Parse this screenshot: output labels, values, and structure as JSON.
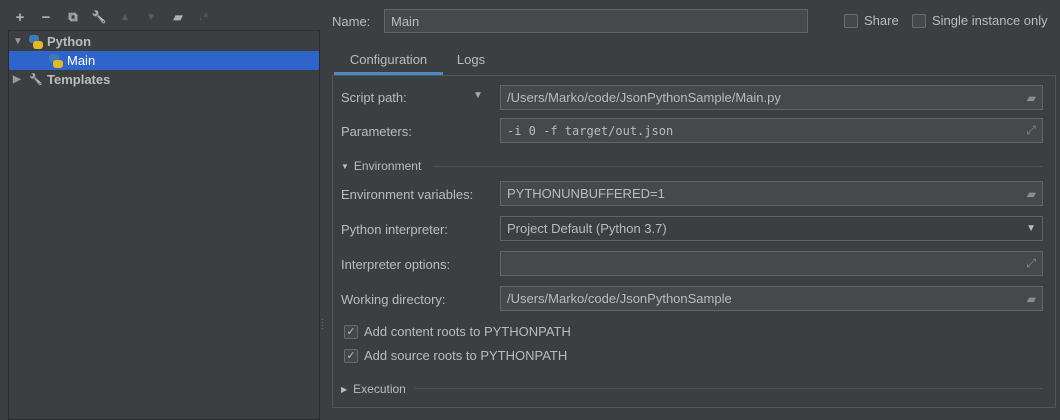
{
  "toolbar": {
    "add": "+",
    "remove": "−",
    "copy": "⧉",
    "edit": "🔧",
    "up": "▲",
    "down": "▼",
    "folder": "▰",
    "sort": "↓ᵃ"
  },
  "tree": {
    "items": [
      {
        "label": "Python"
      },
      {
        "label": "Main"
      },
      {
        "label": "Templates"
      }
    ]
  },
  "header": {
    "name_label": "Name:",
    "name_value": "Main",
    "share": "Share",
    "single_instance": "Single instance only"
  },
  "tabs": [
    {
      "label": "Configuration"
    },
    {
      "label": "Logs"
    }
  ],
  "config": {
    "script_path_label": "Script path:",
    "script_path": "/Users/Marko/code/JsonPythonSample/Main.py",
    "parameters_label": "Parameters:",
    "parameters": "-i 0 -f target/out.json",
    "environment": "Environment",
    "env_vars_label": "Environment variables:",
    "env_vars": "PYTHONUNBUFFERED=1",
    "interpreter_label": "Python interpreter:",
    "interpreter": "Project Default (Python 3.7)",
    "interp_options_label": "Interpreter options:",
    "interp_options": "",
    "working_dir_label": "Working directory:",
    "working_dir": "/Users/Marko/code/JsonPythonSample",
    "content_roots": "Add content roots to PYTHONPATH",
    "source_roots": "Add source roots to PYTHONPATH",
    "execution": "Execution"
  }
}
